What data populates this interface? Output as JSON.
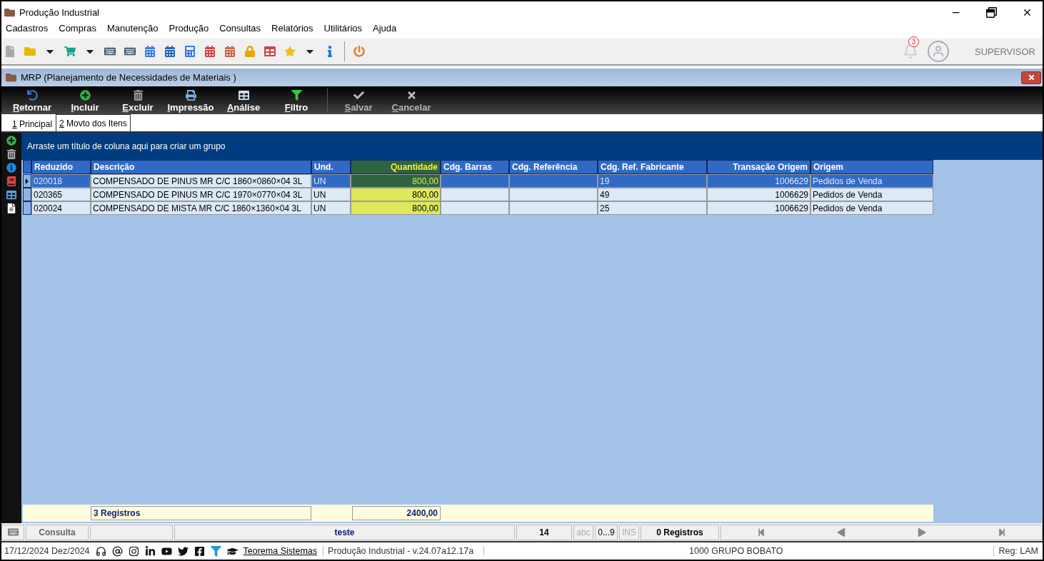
{
  "window": {
    "title": "Produção Industrial"
  },
  "menu": [
    "Cadastros",
    "Compras",
    "Manutenção",
    "Produção",
    "Consultas",
    "Relatórios",
    "Utilitários",
    "Ajuda"
  ],
  "header": {
    "notifications": "3",
    "user": "SUPERVISOR"
  },
  "form": {
    "title": "MRP (Planejamento de Necessidades de Materiais )",
    "actions": [
      {
        "kind": "back",
        "label": "Retornar",
        "disabled": false
      },
      {
        "kind": "add",
        "label": "Incluir",
        "disabled": false
      },
      {
        "kind": "delete",
        "label": "Excluir",
        "disabled": false
      },
      {
        "kind": "print",
        "label": "Impressão",
        "disabled": false
      },
      {
        "kind": "analysis",
        "label": "Análise",
        "disabled": false
      },
      {
        "kind": "filter",
        "label": "Filtro",
        "disabled": false
      },
      {
        "kind": "save",
        "label": "Salvar",
        "disabled": true
      },
      {
        "kind": "cancel",
        "label": "Cancelar",
        "disabled": true
      }
    ],
    "tabs": [
      {
        "label": "1 Principal",
        "selected": false
      },
      {
        "label": "2 Movto dos Itens",
        "selected": true
      }
    ]
  },
  "grid": {
    "group_hint": "Arraste um título de coluna aqui para criar um grupo",
    "columns": [
      {
        "label": "Reduzido",
        "kind": "text",
        "highlight": false
      },
      {
        "label": "Descrição",
        "kind": "text",
        "highlight": false
      },
      {
        "label": "Und.",
        "kind": "text",
        "highlight": false
      },
      {
        "label": "Quantidade",
        "kind": "number",
        "highlight": true
      },
      {
        "label": "Cdg. Barras",
        "kind": "text",
        "highlight": false
      },
      {
        "label": "Cdg. Referência",
        "kind": "text",
        "highlight": false
      },
      {
        "label": "Cdg. Ref. Fabricante",
        "kind": "text",
        "highlight": false
      },
      {
        "label": "Transação Origem",
        "kind": "number",
        "highlight": false
      },
      {
        "label": "Origem",
        "kind": "text",
        "highlight": false
      }
    ],
    "rows": [
      {
        "selected": true,
        "cells": [
          "020018",
          "COMPENSADO DE PINUS MR C/C 1860×0860×04 3L",
          "UN",
          "800,00",
          "",
          "",
          "19",
          "1006629",
          "Pedidos de Venda"
        ]
      },
      {
        "selected": false,
        "cells": [
          "020365",
          "COMPENSADO DE PINUS MR C/C 1970×0770×04 3L",
          "UN",
          "800,00",
          "",
          "",
          "49",
          "1006629",
          "Pedidos de Venda"
        ]
      },
      {
        "selected": false,
        "cells": [
          "020024",
          "COMPENSADO DE MISTA MR C/C 1860×1360×04 3L",
          "UN",
          "800,00",
          "",
          "",
          "25",
          "1006629",
          "Pedidos de Venda"
        ]
      }
    ],
    "footer": {
      "count": "3 Registros",
      "total": "2400,00"
    }
  },
  "status_bar": {
    "mode": "Consulta",
    "caption": "teste",
    "number": "14",
    "abc": {
      "label": "abc",
      "disabled": true
    },
    "digits": {
      "label": "0...9",
      "disabled": false
    },
    "ins": {
      "label": "INS",
      "disabled": true
    },
    "records": "0 Registros"
  },
  "bottom_bar": {
    "date": "17/12/2024 Dez/2024",
    "company_link": "Teorema Sistemas",
    "version": "Produção Industrial - v.24.07a12.17a",
    "group": "1000 GRUPO BOBATO",
    "reg": "Reg: LAM"
  }
}
